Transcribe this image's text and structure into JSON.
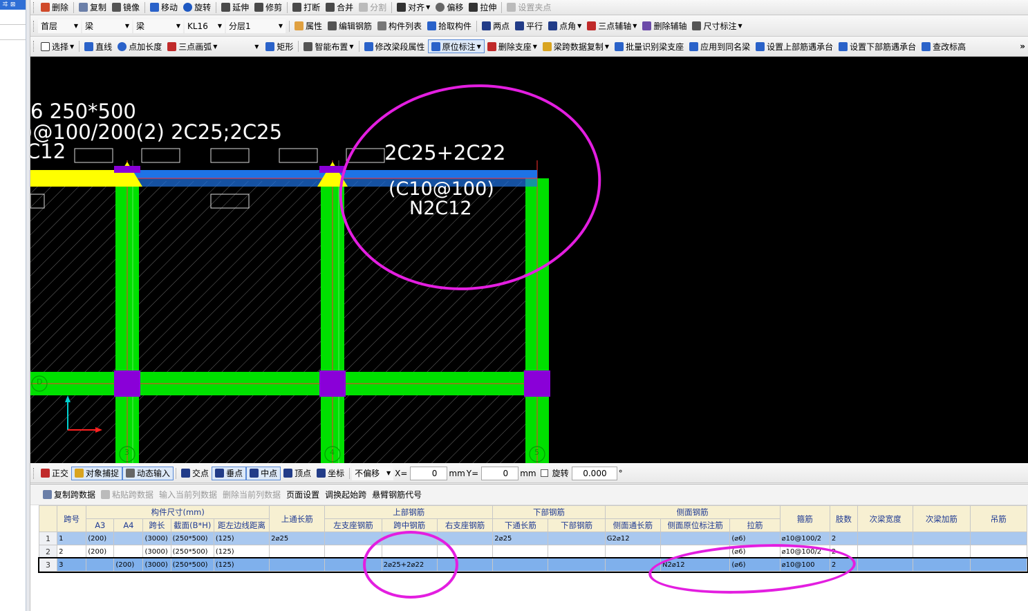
{
  "left_panel": {
    "header_label": "ヰ  ⊠"
  },
  "toolbar1": {
    "items": [
      "删除",
      "复制",
      "镜像",
      "移动",
      "旋转",
      "延伸",
      "修剪",
      "打断",
      "合并",
      "分割",
      "对齐",
      "偏移",
      "拉伸",
      "设置夹点"
    ]
  },
  "toolbar2": {
    "floor": "首层",
    "category": "梁",
    "type": "梁",
    "component": "KL16",
    "layer": "分层1",
    "items": [
      "属性",
      "编辑钢筋",
      "构件列表",
      "拾取构件",
      "两点",
      "平行",
      "点角",
      "三点辅轴",
      "删除辅轴",
      "尺寸标注"
    ]
  },
  "toolbar3": {
    "items": [
      "选择",
      "直线",
      "点加长度",
      "三点画弧",
      "矩形",
      "智能布置",
      "修改梁段属性",
      "原位标注",
      "删除支座",
      "梁跨数据复制",
      "批量识别梁支座",
      "应用到同名梁",
      "设置上部筋遇承台",
      "设置下部筋遇承台",
      "查改标高"
    ],
    "overflow": "»"
  },
  "canvas": {
    "label_line1": "6 250*500",
    "label_line2": ")@100/200(2) 2C25;2C25",
    "label_line3": "C12",
    "span_top": "2C25+2C22",
    "span_stirrup": "(C10@100)",
    "span_side": "N2C12",
    "axis_mark_left": "D",
    "axis_mark_1": "3",
    "axis_mark_2": "4",
    "axis_mark_3": "5"
  },
  "snapbar": {
    "items": [
      "正交",
      "对象捕捉",
      "动态输入",
      "交点",
      "垂点",
      "中点",
      "顶点",
      "坐标"
    ],
    "offset_mode": "不偏移",
    "x_label": "X=",
    "x_value": "0",
    "y_label": "Y=",
    "y_value": "0",
    "unit": "mm",
    "rotate_label": "旋转",
    "rotate_value": "0.000",
    "degree": "°"
  },
  "table_toolbar": {
    "items": [
      "复制跨数据",
      "粘贴跨数据",
      "输入当前列数据",
      "删除当前列数据",
      "页面设置",
      "调换起始跨",
      "悬臂钢筋代号"
    ]
  },
  "table": {
    "group_headers": [
      "跨号",
      "构件尺寸(mm)",
      "上通长筋",
      "上部钢筋",
      "下部钢筋",
      "侧面钢筋",
      "箍筋",
      "肢数",
      "次梁宽度",
      "次梁加筋",
      "吊筋"
    ],
    "sub_headers": [
      "A3",
      "A4",
      "跨长",
      "截面(B*H)",
      "距左边线距离",
      "左支座钢筋",
      "跨中钢筋",
      "右支座钢筋",
      "下通长筋",
      "下部钢筋",
      "侧面通长筋",
      "侧面原位标注筋",
      "拉筋"
    ],
    "rows": [
      {
        "n": "1",
        "span": "1",
        "a3": "(200)",
        "a4": "",
        "len": "(3000)",
        "sec": "(250*500)",
        "dist": "(125)",
        "top_cont": "2⌀25",
        "left_sup": "",
        "mid": "",
        "right_sup": "",
        "bot_cont": "2⌀25",
        "bot": "",
        "side_cont": "G2⌀12",
        "side_in": "",
        "tie": "(⌀6)",
        "stirrup": "⌀10@100/2",
        "legs": "2",
        "sb_w": "",
        "sb_add": "",
        "hang": ""
      },
      {
        "n": "2",
        "span": "2",
        "a3": "(200)",
        "a4": "",
        "len": "(3000)",
        "sec": "(250*500)",
        "dist": "(125)",
        "top_cont": "",
        "left_sup": "",
        "mid": "",
        "right_sup": "",
        "bot_cont": "",
        "bot": "",
        "side_cont": "",
        "side_in": "",
        "tie": "(⌀6)",
        "stirrup": "⌀10@100/2",
        "legs": "2",
        "sb_w": "",
        "sb_add": "",
        "hang": ""
      },
      {
        "n": "3",
        "span": "3",
        "a3": "",
        "a4": "(200)",
        "len": "(3000)",
        "sec": "(250*500)",
        "dist": "(125)",
        "top_cont": "",
        "left_sup": "",
        "mid": "2⌀25+2⌀22",
        "right_sup": "",
        "bot_cont": "",
        "bot": "",
        "side_cont": "",
        "side_in": "N2⌀12",
        "tie": "(⌀6)",
        "stirrup": "⌀10@100",
        "legs": "2",
        "sb_w": "",
        "sb_add": "",
        "hang": ""
      }
    ]
  },
  "colors": {
    "canvas_bg": "#000000",
    "column_green": "#00e000",
    "node_purple": "#8a00d8",
    "beam_blue": "#1e73e6",
    "selected_yellow": "#ffff00",
    "marker_magenta": "#e31ee0"
  }
}
